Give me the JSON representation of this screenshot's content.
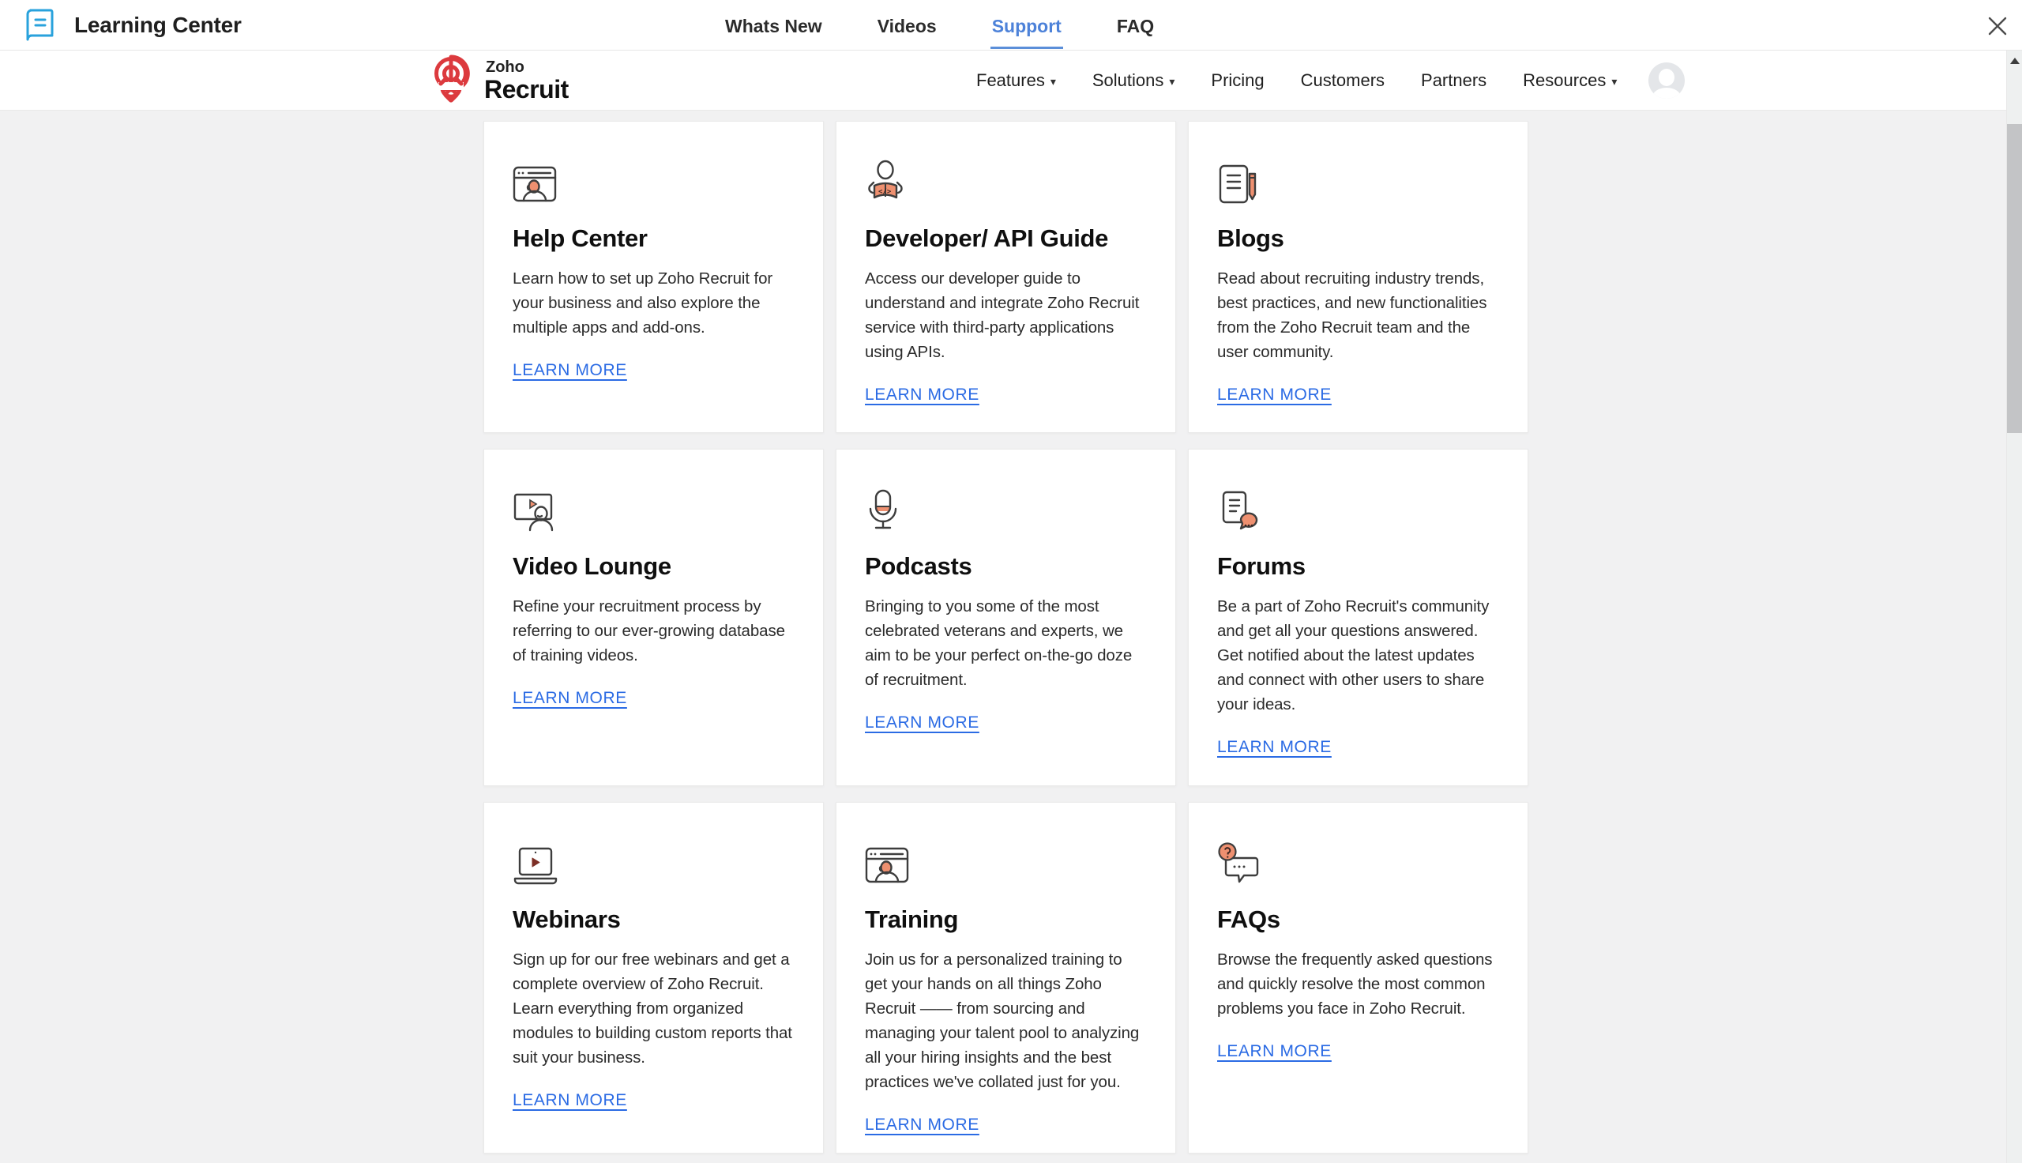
{
  "header": {
    "app_title": "Learning Center",
    "close_icon": "close"
  },
  "top_nav": {
    "items": [
      {
        "label": "Whats New",
        "active": false
      },
      {
        "label": "Videos",
        "active": false
      },
      {
        "label": "Support",
        "active": true
      },
      {
        "label": "FAQ",
        "active": false
      }
    ]
  },
  "brand": {
    "company": "Zoho",
    "product": "Recruit"
  },
  "site_nav": {
    "caret": "▾",
    "items": [
      {
        "label": "Features",
        "dropdown": true
      },
      {
        "label": "Solutions",
        "dropdown": true
      },
      {
        "label": "Pricing",
        "dropdown": false
      },
      {
        "label": "Customers",
        "dropdown": false
      },
      {
        "label": "Partners",
        "dropdown": false
      },
      {
        "label": "Resources",
        "dropdown": true
      }
    ]
  },
  "cards": [
    {
      "icon": "browser-person-icon",
      "title": "Help Center",
      "description": "Learn how to set up Zoho Recruit for your business and also explore the multiple apps and add-ons.",
      "link_label": "LEARN MORE"
    },
    {
      "icon": "developer-book-icon",
      "title": "Developer/ API Guide",
      "description": "Access our developer guide to understand and integrate Zoho Recruit service with third-party applications using APIs.",
      "link_label": "LEARN MORE"
    },
    {
      "icon": "document-pencil-icon",
      "title": "Blogs",
      "description": "Read about recruiting industry trends, best practices, and new functionalities from the Zoho Recruit team and the user community.",
      "link_label": "LEARN MORE"
    },
    {
      "icon": "screen-presenter-icon",
      "title": "Video Lounge",
      "description": "Refine your recruitment process by referring to our ever-growing database of training videos.",
      "link_label": "LEARN MORE"
    },
    {
      "icon": "microphone-icon",
      "title": "Podcasts",
      "description": "Bringing to you some of the most celebrated veterans and experts, we aim to be your perfect on-the-go doze of recruitment.",
      "link_label": "LEARN MORE"
    },
    {
      "icon": "document-chat-icon",
      "title": "Forums",
      "description": "Be a part of Zoho Recruit's community and get all your questions answered. Get notified about the latest updates and connect with other users to share your ideas.",
      "link_label": "LEARN MORE"
    },
    {
      "icon": "laptop-play-icon",
      "title": "Webinars",
      "description": "Sign up for our free webinars and get a complete overview of Zoho Recruit. Learn everything from organized modules to building custom reports that suit your business.",
      "link_label": "LEARN MORE"
    },
    {
      "icon": "browser-person-icon",
      "title": "Training",
      "description": "Join us for a personalized training to get your hands on all things Zoho Recruit —— from sourcing and managing your talent pool to analyzing all your hiring insights and the best practices we've collated just for you.",
      "link_label": "LEARN MORE"
    },
    {
      "icon": "question-chat-icon",
      "title": "FAQs",
      "description": "Browse the frequently asked questions and quickly resolve the most common problems you face in Zoho Recruit.",
      "link_label": "LEARN MORE"
    }
  ],
  "colors": {
    "active_nav_blue": "#4d82d9",
    "link_blue": "#2b6be4",
    "brand_red": "#dc3a3e",
    "icon_accent_salmon": "#ee9070",
    "logo_book_blue": "#29a2dc",
    "page_background": "#f1f1f2"
  }
}
